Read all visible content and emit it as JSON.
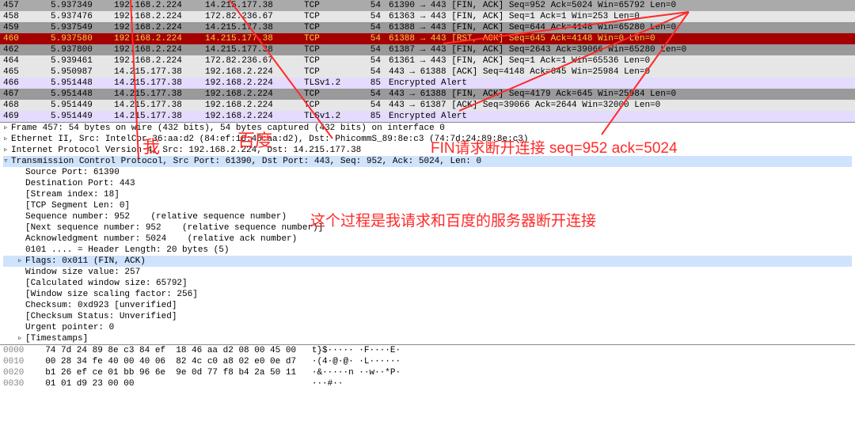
{
  "packets": [
    {
      "no": "457",
      "time": "5.937349",
      "src": "192.168.2.224",
      "dst": "14.215.177.38",
      "proto": "TCP",
      "len": "54",
      "info": "61390 → 443 [FIN, ACK] Seq=952 Ack=5024 Win=65792 Len=0",
      "cls": "row-dark"
    },
    {
      "no": "458",
      "time": "5.937476",
      "src": "192.168.2.224",
      "dst": "172.82.236.67",
      "proto": "TCP",
      "len": "54",
      "info": "61363 → 443 [FIN, ACK] Seq=1 Ack=1 Win=253 Len=0",
      "cls": "row-grey"
    },
    {
      "no": "459",
      "time": "5.937549",
      "src": "192.168.2.224",
      "dst": "14.215.177.38",
      "proto": "TCP",
      "len": "54",
      "info": "61388 → 443 [FIN, ACK] Seq=644 Ack=4148 Win=65280 Len=0",
      "cls": "row-darker"
    },
    {
      "no": "460",
      "time": "5.937580",
      "src": "192.168.2.224",
      "dst": "14.215.177.38",
      "proto": "TCP",
      "len": "54",
      "info": "61388 → 443 [RST, ACK] Seq=645 Ack=4148 Win=0 Len=0",
      "cls": "row-red"
    },
    {
      "no": "462",
      "time": "5.937800",
      "src": "192.168.2.224",
      "dst": "14.215.177.38",
      "proto": "TCP",
      "len": "54",
      "info": "61387 → 443 [FIN, ACK] Seq=2643 Ack=39066 Win=65280 Len=0",
      "cls": "row-darker"
    },
    {
      "no": "464",
      "time": "5.939461",
      "src": "192.168.2.224",
      "dst": "172.82.236.67",
      "proto": "TCP",
      "len": "54",
      "info": "61361 → 443 [FIN, ACK] Seq=1 Ack=1 Win=65536 Len=0",
      "cls": "row-grey"
    },
    {
      "no": "465",
      "time": "5.950987",
      "src": "14.215.177.38",
      "dst": "192.168.2.224",
      "proto": "TCP",
      "len": "54",
      "info": "443 → 61388 [ACK] Seq=4148 Ack=645 Win=25984 Len=0",
      "cls": "row-grey"
    },
    {
      "no": "466",
      "time": "5.951448",
      "src": "14.215.177.38",
      "dst": "192.168.2.224",
      "proto": "TLSv1.2",
      "len": "85",
      "info": "Encrypted Alert",
      "cls": "row-purple"
    },
    {
      "no": "467",
      "time": "5.951448",
      "src": "14.215.177.38",
      "dst": "192.168.2.224",
      "proto": "TCP",
      "len": "54",
      "info": "443 → 61388 [FIN, ACK] Seq=4179 Ack=645 Win=25984 Len=0",
      "cls": "row-darker"
    },
    {
      "no": "468",
      "time": "5.951449",
      "src": "14.215.177.38",
      "dst": "192.168.2.224",
      "proto": "TCP",
      "len": "54",
      "info": "443 → 61387 [ACK] Seq=39066 Ack=2644 Win=32000 Len=0",
      "cls": "row-grey"
    },
    {
      "no": "469",
      "time": "5.951449",
      "src": "14.215.177.38",
      "dst": "192.168.2.224",
      "proto": "TLSv1.2",
      "len": "85",
      "info": "Encrypted Alert",
      "cls": "row-purple"
    }
  ],
  "details": {
    "frame": "Frame 457: 54 bytes on wire (432 bits), 54 bytes captured (432 bits) on interface 0",
    "eth": "Ethernet II, Src: IntelCor_36:aa:d2 (84:ef:18:46:aa:d2), Dst: PhicommS_89:8e:c3 (74:7d:24:89:8e:c3)",
    "ip": "Internet Protocol Version 4, Src: 192.168.2.224, Dst: 14.215.177.38",
    "tcp": "Transmission Control Protocol, Src Port: 61390, Dst Port: 443, Seq: 952, Ack: 5024, Len: 0",
    "srcport": "Source Port: 61390",
    "dstport": "Destination Port: 443",
    "stream": "[Stream index: 18]",
    "seglen": "[TCP Segment Len: 0]",
    "seqnum": "Sequence number: 952    (relative sequence number)",
    "nextseq": "[Next sequence number: 952    (relative sequence number)]",
    "acknum": "Acknowledgment number: 5024    (relative ack number)",
    "hdrlen": "0101 .... = Header Length: 20 bytes (5)",
    "flags": "Flags: 0x011 (FIN, ACK)",
    "winval": "Window size value: 257",
    "calcwin": "[Calculated window size: 65792]",
    "winscl": "[Window size scaling factor: 256]",
    "cksum": "Checksum: 0xd923 [unverified]",
    "cksumst": "[Checksum Status: Unverified]",
    "urgptr": "Urgent pointer: 0",
    "timestamps": "[Timestamps]"
  },
  "hex": [
    {
      "addr": "0000",
      "bytes": "74 7d 24 89 8e c3 84 ef  18 46 aa d2 08 00 45 00",
      "ascii": "t}$····· ·F····E·"
    },
    {
      "addr": "0010",
      "bytes": "00 28 34 fe 40 00 40 06  82 4c c0 a8 02 e0 0e d7",
      "ascii": "·(4·@·@· ·L······"
    },
    {
      "addr": "0020",
      "bytes": "b1 26 ef ce 01 bb 96 6e  9e 0d 77 f8 b4 2a 50 11",
      "ascii": "·&·····n ··w··*P·"
    },
    {
      "addr": "0030",
      "bytes": "01 01 d9 23 00 00",
      "ascii": "···#··"
    }
  ],
  "annotations": {
    "me": "我",
    "baidu": "百度",
    "fin": "FIN请求断开连接  seq=952   ack=5024",
    "desc": "这个过程是我请求和百度的服务器断开连接"
  }
}
